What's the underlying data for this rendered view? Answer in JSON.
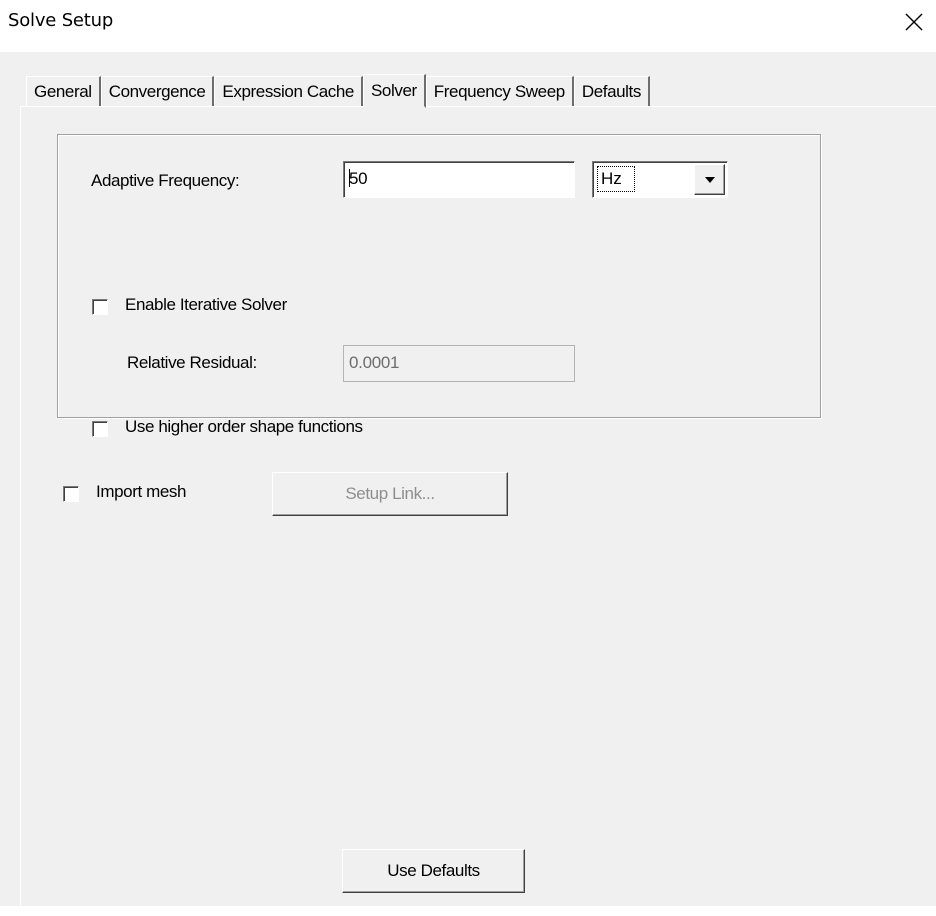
{
  "window": {
    "title": "Solve Setup",
    "close_icon": "close-icon"
  },
  "tabs": [
    {
      "label": "General",
      "active": false
    },
    {
      "label": "Convergence",
      "active": false
    },
    {
      "label": "Expression Cache",
      "active": false
    },
    {
      "label": "Solver",
      "active": true
    },
    {
      "label": "Frequency Sweep",
      "active": false
    },
    {
      "label": "Defaults",
      "active": false
    }
  ],
  "solver": {
    "adaptive_frequency_label": "Adaptive Frequency:",
    "adaptive_frequency_value": "50",
    "adaptive_frequency_unit": "Hz",
    "enable_iterative_solver_label": "Enable Iterative Solver",
    "enable_iterative_solver_checked": false,
    "relative_residual_label": "Relative Residual:",
    "relative_residual_value": "0.0001",
    "higher_order_label": "Use higher order shape functions",
    "higher_order_checked": false,
    "import_mesh_label": "Import mesh",
    "import_mesh_checked": false,
    "setup_link_label": "Setup Link...",
    "use_defaults_label": "Use Defaults"
  },
  "colors": {
    "client_bg": "#f0f0f0",
    "titlebar_bg": "#ffffff",
    "disabled_text": "#6d6d6d"
  }
}
